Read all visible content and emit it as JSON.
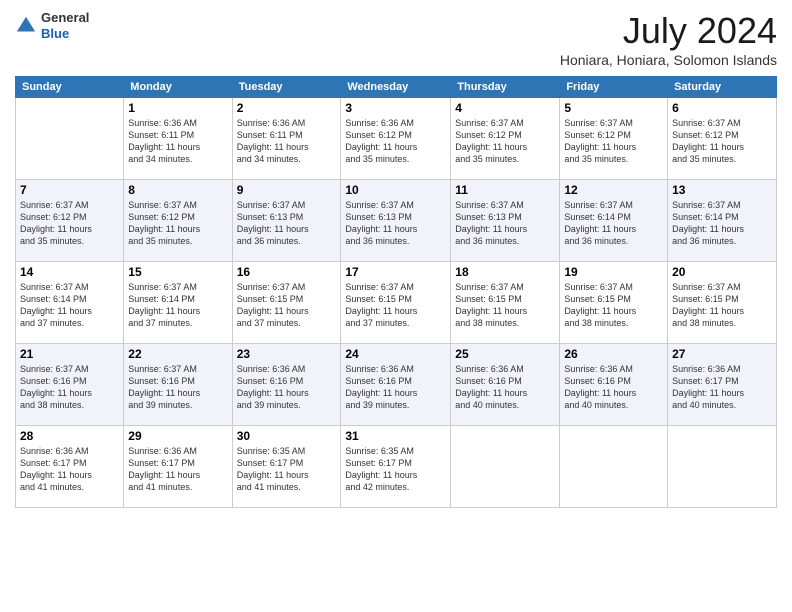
{
  "header": {
    "logo": {
      "general": "General",
      "blue": "Blue"
    },
    "title": "July 2024",
    "subtitle": "Honiara, Honiara, Solomon Islands"
  },
  "calendar": {
    "days_of_week": [
      "Sunday",
      "Monday",
      "Tuesday",
      "Wednesday",
      "Thursday",
      "Friday",
      "Saturday"
    ],
    "weeks": [
      [
        {
          "day": "",
          "info": ""
        },
        {
          "day": "1",
          "info": "Sunrise: 6:36 AM\nSunset: 6:11 PM\nDaylight: 11 hours\nand 34 minutes."
        },
        {
          "day": "2",
          "info": "Sunrise: 6:36 AM\nSunset: 6:11 PM\nDaylight: 11 hours\nand 34 minutes."
        },
        {
          "day": "3",
          "info": "Sunrise: 6:36 AM\nSunset: 6:12 PM\nDaylight: 11 hours\nand 35 minutes."
        },
        {
          "day": "4",
          "info": "Sunrise: 6:37 AM\nSunset: 6:12 PM\nDaylight: 11 hours\nand 35 minutes."
        },
        {
          "day": "5",
          "info": "Sunrise: 6:37 AM\nSunset: 6:12 PM\nDaylight: 11 hours\nand 35 minutes."
        },
        {
          "day": "6",
          "info": "Sunrise: 6:37 AM\nSunset: 6:12 PM\nDaylight: 11 hours\nand 35 minutes."
        }
      ],
      [
        {
          "day": "7",
          "info": "Sunrise: 6:37 AM\nSunset: 6:12 PM\nDaylight: 11 hours\nand 35 minutes."
        },
        {
          "day": "8",
          "info": "Sunrise: 6:37 AM\nSunset: 6:12 PM\nDaylight: 11 hours\nand 35 minutes."
        },
        {
          "day": "9",
          "info": "Sunrise: 6:37 AM\nSunset: 6:13 PM\nDaylight: 11 hours\nand 36 minutes."
        },
        {
          "day": "10",
          "info": "Sunrise: 6:37 AM\nSunset: 6:13 PM\nDaylight: 11 hours\nand 36 minutes."
        },
        {
          "day": "11",
          "info": "Sunrise: 6:37 AM\nSunset: 6:13 PM\nDaylight: 11 hours\nand 36 minutes."
        },
        {
          "day": "12",
          "info": "Sunrise: 6:37 AM\nSunset: 6:14 PM\nDaylight: 11 hours\nand 36 minutes."
        },
        {
          "day": "13",
          "info": "Sunrise: 6:37 AM\nSunset: 6:14 PM\nDaylight: 11 hours\nand 36 minutes."
        }
      ],
      [
        {
          "day": "14",
          "info": "Sunrise: 6:37 AM\nSunset: 6:14 PM\nDaylight: 11 hours\nand 37 minutes."
        },
        {
          "day": "15",
          "info": "Sunrise: 6:37 AM\nSunset: 6:14 PM\nDaylight: 11 hours\nand 37 minutes."
        },
        {
          "day": "16",
          "info": "Sunrise: 6:37 AM\nSunset: 6:15 PM\nDaylight: 11 hours\nand 37 minutes."
        },
        {
          "day": "17",
          "info": "Sunrise: 6:37 AM\nSunset: 6:15 PM\nDaylight: 11 hours\nand 37 minutes."
        },
        {
          "day": "18",
          "info": "Sunrise: 6:37 AM\nSunset: 6:15 PM\nDaylight: 11 hours\nand 38 minutes."
        },
        {
          "day": "19",
          "info": "Sunrise: 6:37 AM\nSunset: 6:15 PM\nDaylight: 11 hours\nand 38 minutes."
        },
        {
          "day": "20",
          "info": "Sunrise: 6:37 AM\nSunset: 6:15 PM\nDaylight: 11 hours\nand 38 minutes."
        }
      ],
      [
        {
          "day": "21",
          "info": "Sunrise: 6:37 AM\nSunset: 6:16 PM\nDaylight: 11 hours\nand 38 minutes."
        },
        {
          "day": "22",
          "info": "Sunrise: 6:37 AM\nSunset: 6:16 PM\nDaylight: 11 hours\nand 39 minutes."
        },
        {
          "day": "23",
          "info": "Sunrise: 6:36 AM\nSunset: 6:16 PM\nDaylight: 11 hours\nand 39 minutes."
        },
        {
          "day": "24",
          "info": "Sunrise: 6:36 AM\nSunset: 6:16 PM\nDaylight: 11 hours\nand 39 minutes."
        },
        {
          "day": "25",
          "info": "Sunrise: 6:36 AM\nSunset: 6:16 PM\nDaylight: 11 hours\nand 40 minutes."
        },
        {
          "day": "26",
          "info": "Sunrise: 6:36 AM\nSunset: 6:16 PM\nDaylight: 11 hours\nand 40 minutes."
        },
        {
          "day": "27",
          "info": "Sunrise: 6:36 AM\nSunset: 6:17 PM\nDaylight: 11 hours\nand 40 minutes."
        }
      ],
      [
        {
          "day": "28",
          "info": "Sunrise: 6:36 AM\nSunset: 6:17 PM\nDaylight: 11 hours\nand 41 minutes."
        },
        {
          "day": "29",
          "info": "Sunrise: 6:36 AM\nSunset: 6:17 PM\nDaylight: 11 hours\nand 41 minutes."
        },
        {
          "day": "30",
          "info": "Sunrise: 6:35 AM\nSunset: 6:17 PM\nDaylight: 11 hours\nand 41 minutes."
        },
        {
          "day": "31",
          "info": "Sunrise: 6:35 AM\nSunset: 6:17 PM\nDaylight: 11 hours\nand 42 minutes."
        },
        {
          "day": "",
          "info": ""
        },
        {
          "day": "",
          "info": ""
        },
        {
          "day": "",
          "info": ""
        }
      ]
    ]
  }
}
